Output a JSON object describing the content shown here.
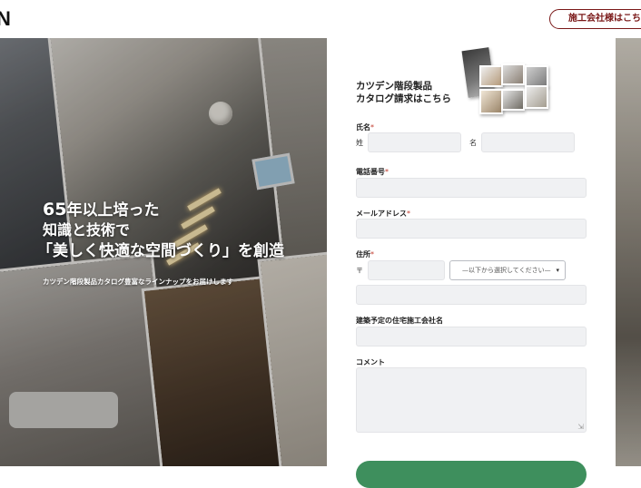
{
  "header": {
    "logo_fragment": "N",
    "contractor_button": "施工会社様はこち"
  },
  "hero": {
    "line1_number": "65",
    "line1_rest": "年以上培った",
    "line2": "知識と技術で",
    "line3": "「美しく快適な空間づくり」を創造",
    "subline": "カツデン階段製品カタログ豊富なラインナップをお届けします"
  },
  "form": {
    "catalog_title_line1": "カツデン階段製品",
    "catalog_title_line2": "カタログ請求はこちら",
    "name_label": "氏名",
    "last_name_label": "姓",
    "first_name_label": "名",
    "phone_label": "電話番号",
    "email_label": "メールアドレス",
    "address_label": "住所",
    "postal_mark": "〒",
    "prefecture_select": "—以下から選択してください—",
    "builder_label": "建築予定の住宅施工会社名",
    "comment_label": "コメント",
    "required_mark": "*"
  },
  "colors": {
    "accent_dark_red": "#7a1818",
    "required_red": "#c0392b",
    "submit_green": "#3e8f5d",
    "field_bg": "#f0f1f3"
  }
}
